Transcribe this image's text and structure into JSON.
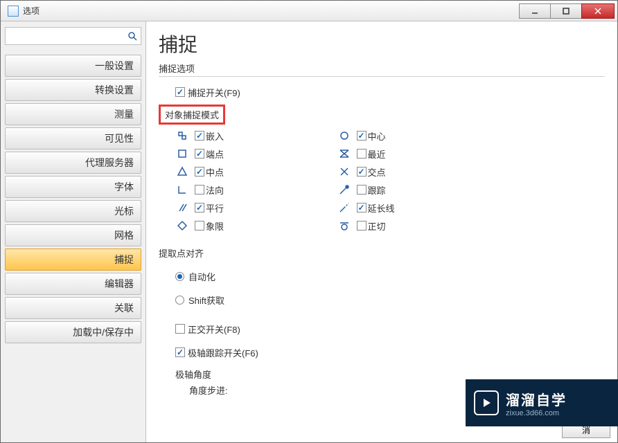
{
  "window": {
    "title": "选项"
  },
  "sidebar": {
    "search_placeholder": "",
    "items": [
      {
        "label": "一般设置"
      },
      {
        "label": "转换设置"
      },
      {
        "label": "测量"
      },
      {
        "label": "可见性"
      },
      {
        "label": "代理服务器"
      },
      {
        "label": "字体"
      },
      {
        "label": "光标"
      },
      {
        "label": "网格"
      },
      {
        "label": "捕捉"
      },
      {
        "label": "编辑器"
      },
      {
        "label": "关联"
      },
      {
        "label": "加载中/保存中"
      }
    ]
  },
  "page": {
    "title": "捕捉",
    "section_snap_options": "捕捉选项",
    "snap_toggle": "捕捉开关(F9)",
    "osnap_mode": "对象捕捉模式",
    "modes_left": [
      {
        "icon": "insert",
        "label": "嵌入",
        "checked": true
      },
      {
        "icon": "endpoint",
        "label": "端点",
        "checked": true
      },
      {
        "icon": "midpoint",
        "label": "中点",
        "checked": true
      },
      {
        "icon": "perpendicular",
        "label": "法向",
        "checked": false
      },
      {
        "icon": "parallel",
        "label": "平行",
        "checked": true
      },
      {
        "icon": "quadrant",
        "label": "象限",
        "checked": false
      }
    ],
    "modes_right": [
      {
        "icon": "center",
        "label": "中心",
        "checked": true
      },
      {
        "icon": "nearest",
        "label": "最近",
        "checked": false
      },
      {
        "icon": "intersection",
        "label": "交点",
        "checked": true
      },
      {
        "icon": "track",
        "label": "跟踪",
        "checked": false
      },
      {
        "icon": "extension",
        "label": "延长线",
        "checked": true
      },
      {
        "icon": "tangent",
        "label": "正切",
        "checked": false
      }
    ],
    "section_align": "提取点对齐",
    "align_auto": "自动化",
    "align_shift": "Shift获取",
    "ortho": "正交开关(F8)",
    "polar": "极轴跟踪开关(F6)",
    "section_polar_angle": "极轴角度",
    "angle_step": "角度步进:"
  },
  "watermark": {
    "main": "溜溜自学",
    "sub": "zixue.3d66.com"
  },
  "footer": {
    "cancel": "消"
  }
}
